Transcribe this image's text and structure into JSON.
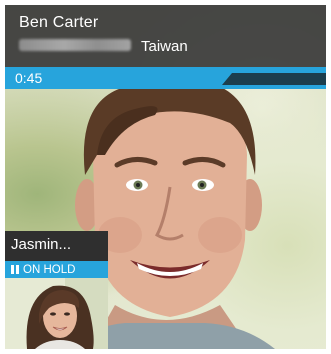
{
  "call": {
    "caller_name": "Ben Carter",
    "caller_location": "Taiwan",
    "elapsed_time": "0:45"
  },
  "on_hold": {
    "name": "Jasmin...",
    "status": "ON HOLD"
  },
  "colors": {
    "accent": "#27a4dc",
    "header_bg": "#3a3a3a",
    "signal_track": "#1c3e4d"
  },
  "icons": {
    "pause": "pause-icon",
    "caller_video": "caller-face",
    "on_hold_thumbnail": "woman-face"
  }
}
